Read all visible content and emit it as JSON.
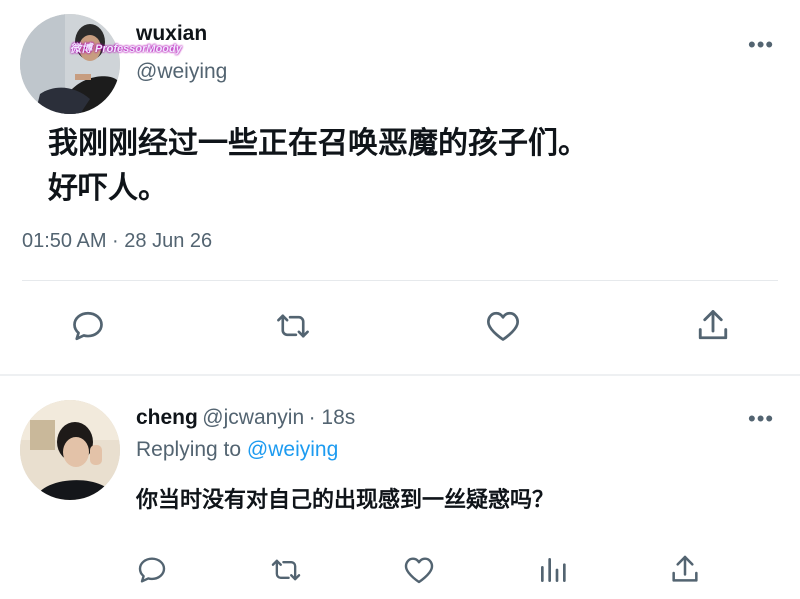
{
  "tweet": {
    "author_name": "wuxian",
    "author_handle": "@weiying",
    "avatar_watermark": "微博 ProfessorMoody",
    "text_line1": "我刚刚经过一些正在召唤恶魔的孩子们。",
    "text_line2": "好吓人。",
    "timestamp": "01:50 AM · 28 Jun 26",
    "more_label": "•••",
    "actions": [
      "reply-icon",
      "retweet-icon",
      "like-icon",
      "share-icon"
    ]
  },
  "reply": {
    "author_name": "cheng",
    "author_handle": "@jcwanyin",
    "time": "· 18s",
    "replying_to_prefix": "Replying to",
    "replying_to_handle": "@weiying",
    "text": "你当时没有对自己的出现感到一丝疑惑吗？",
    "more_label": "•••",
    "actions": [
      "reply-icon",
      "retweet-icon",
      "like-icon",
      "views-icon",
      "share-icon"
    ]
  },
  "colors": {
    "text": "#0f1419",
    "secondary": "#536471",
    "link": "#1d9bf0",
    "divider": "#e6e9ec"
  }
}
